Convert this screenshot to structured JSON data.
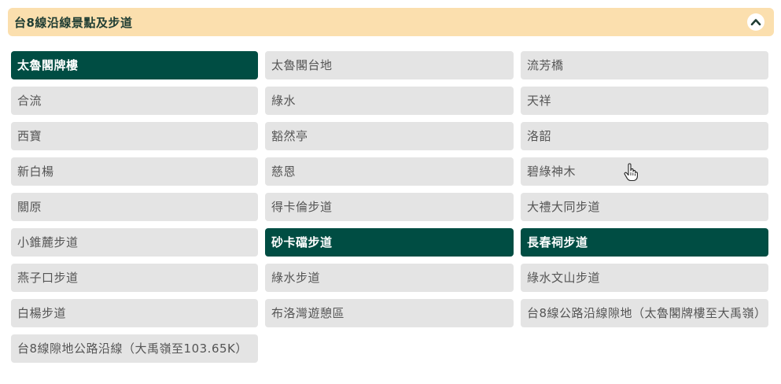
{
  "section": {
    "title": "台8線沿線景點及步道",
    "toggle_icon": "chevron-up-icon"
  },
  "colors": {
    "header_bg": "#fbdfae",
    "tile_bg": "#e4e4e4",
    "tile_active_bg": "#004d43"
  },
  "items": [
    {
      "label": "太魯閣牌樓",
      "active": true
    },
    {
      "label": "太魯閣台地",
      "active": false
    },
    {
      "label": "流芳橋",
      "active": false
    },
    {
      "label": "合流",
      "active": false
    },
    {
      "label": "綠水",
      "active": false
    },
    {
      "label": "天祥",
      "active": false
    },
    {
      "label": "西寶",
      "active": false
    },
    {
      "label": "豁然亭",
      "active": false
    },
    {
      "label": "洛韶",
      "active": false
    },
    {
      "label": "新白楊",
      "active": false
    },
    {
      "label": "慈恩",
      "active": false
    },
    {
      "label": "碧綠神木",
      "active": false
    },
    {
      "label": "關原",
      "active": false
    },
    {
      "label": "得卡倫步道",
      "active": false
    },
    {
      "label": "大禮大同步道",
      "active": false
    },
    {
      "label": "小錐麓步道",
      "active": false
    },
    {
      "label": "砂卡礑步道",
      "active": true
    },
    {
      "label": "長春祠步道",
      "active": true
    },
    {
      "label": "燕子口步道",
      "active": false
    },
    {
      "label": "綠水步道",
      "active": false
    },
    {
      "label": "綠水文山步道",
      "active": false
    },
    {
      "label": "白楊步道",
      "active": false
    },
    {
      "label": "布洛灣遊憩區",
      "active": false
    },
    {
      "label": "台8線公路沿線隙地（太魯閣牌樓至大禹嶺）",
      "active": false
    },
    {
      "label": "台8線隙地公路沿線（大禹嶺至103.65K）",
      "active": false
    }
  ]
}
